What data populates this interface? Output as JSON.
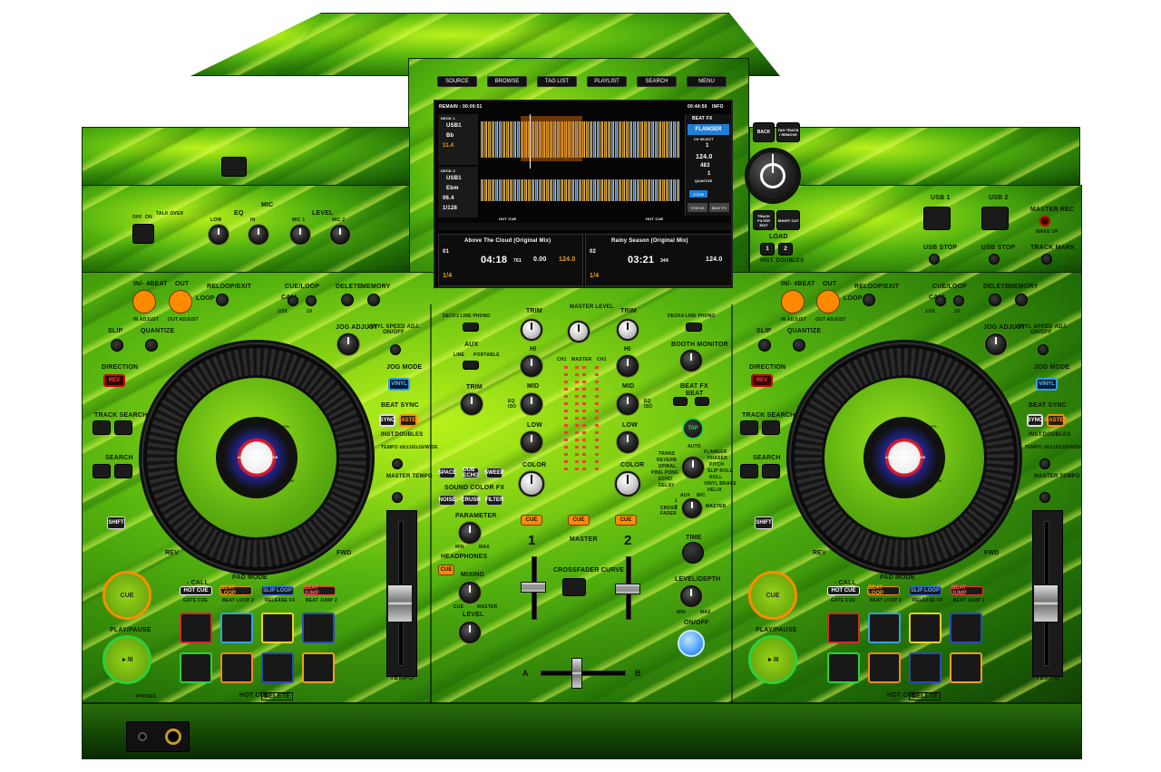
{
  "screen": {
    "top_buttons": [
      "SOURCE",
      "BROWSE",
      "TAG LIST",
      "PLAYLIST",
      "SEARCH",
      "MENU"
    ],
    "remain_label": "REMAIN : 00:00:51",
    "clock": "00:44:50",
    "info_label": "INFO",
    "deck1": {
      "label": "DECK 1",
      "source": "USB1",
      "key": "Bb",
      "bpm_small": "11.4",
      "track_no": "01",
      "title": "Above The Cloud (Original Mix)",
      "time": "04:18",
      "time_ms": "761",
      "tempo": "0.00",
      "bpm": "124.0",
      "quantize": "1/4"
    },
    "deck2": {
      "label": "DECK 2",
      "source": "USB1",
      "key": "Ebm",
      "bpm_small": "06.4",
      "beat_count": "1/128",
      "track_no": "02",
      "title": "Rainy Season (Original Mix)",
      "time": "03:21",
      "time_ms": "344",
      "bpm": "124.0",
      "quantize": "1/4"
    },
    "beat_fx": {
      "header": "BEAT FX",
      "name": "FLANGER",
      "ch": "CH SELECT",
      "value": "1",
      "bpm": "124.0",
      "ms": "483",
      "beat": "1",
      "quantize": "QUANTIZE",
      "zoom": "ZOOM",
      "status": "STATUS",
      "beatfx": "BEAT FX"
    },
    "hot_cue": "HOT CUE"
  },
  "nav": {
    "back": "BACK",
    "tag": "TAG TRACK / REMOVE",
    "track_filter": "TRACK FILTER EDIT",
    "shortcut": "SHORT CUT",
    "load": "LOAD",
    "inst_doubles": "INST. DOUBLES",
    "load1": "1",
    "load2": "2"
  },
  "mic": {
    "title": "MIC",
    "eq": "EQ",
    "level": "LEVEL",
    "off": "OFF",
    "on": "ON",
    "talk_over": "TALK OVER",
    "low": "LOW",
    "hi": "HI",
    "mic1": "MIC 1",
    "mic2": "MIC 2"
  },
  "usb": {
    "usb1": "USB 1",
    "usb2": "USB 2",
    "usb_stop": "USB STOP",
    "master_rec": "MASTER REC",
    "wake_up": "WAKE UP",
    "track_mark": "TRACK MARK"
  },
  "deck_left": {
    "in_beat": "IN/- 4BEAT",
    "out": "OUT",
    "reloop": "RELOOP/EXIT",
    "loop": "LOOP",
    "in_adjust": "IN ADJUST",
    "out_adjust": "OUT ADJUST",
    "cue_loop": "CUE/LOOP",
    "call": "CALL",
    "delete": "DELETE",
    "memory": "MEMORY",
    "half": "1/2X",
    "double": "2X",
    "slip": "SLIP",
    "quantize": "QUANTIZE",
    "jog_adjust": "JOG ADJUST",
    "vinyl_speed": "VINYL SPEED ADJ. ON/OFF",
    "direction": "DIRECTION",
    "rev": "REV",
    "jog_mode": "JOG MODE",
    "vinyl": "VINYL",
    "track_search": "TRACK SEARCH",
    "search": "SEARCH",
    "beat_sync": "BEAT SYNC",
    "sync": "SYNC",
    "master": "MASTER",
    "inst_doubles": "INST.DOUBLES",
    "tempo_range": "TEMPO ±6/±10/±16/WIDE",
    "master_tempo": "MASTER TEMPO",
    "shift": "SHIFT",
    "rev_label": "REV",
    "fwd": "FWD",
    "cue": "CUE",
    "play_pause": "PLAY/PAUSE",
    "play_glyph": "►/II",
    "pad_mode": "PAD MODE",
    "pad_call": "- CALL",
    "hot_cue": "HOT CUE",
    "beat_loop": "BEAT LOOP",
    "slip_loop": "SLIP LOOP",
    "beat_jump": "BEAT JUMP",
    "gate_cue": "GATE CUE",
    "beat_loop2": "BEAT LOOP 2",
    "release_fx": "RELEASE FX",
    "beat_jump2": "BEAT JUMP 2",
    "hot_cue_delete": "HOT CUE",
    "delete_tag": "DELETE",
    "tempo": "TEMPO",
    "phones": "PHONES",
    "jog_mode_label": "MODE",
    "jog_vinyl": "VINYL",
    "jog_sync": "SYNC",
    "jog_master": "MASTER",
    "jog_beat_sync": "BEAT SYNC",
    "jog_track": "ABOVE THE CLOUDS",
    "jog_artist": "LANDMARK"
  },
  "mixer": {
    "deck3_line_phono": "DECK3 LINE PHONO",
    "deck4_line_phono": "DECK4 LINE PHONO",
    "aux": "AUX",
    "portable": "PORTABLE",
    "line": "LINE",
    "trim": "TRIM",
    "master_level": "MASTER LEVEL",
    "hi": "HI",
    "mid": "MID",
    "low": "LOW",
    "eq_iso": "EQ ISO",
    "color": "COLOR",
    "ch1": "CH1",
    "master_meter": "MASTER",
    "ch2": "CH2",
    "booth_monitor": "BOOTH MONITOR",
    "beat_fx": "BEAT FX",
    "beat": "BEAT",
    "tap": "TAP",
    "auto": "AUTO",
    "fx_list_left": [
      "TRANS",
      "REVERB",
      "SPIRAL",
      "PING PONG",
      "ECHO",
      "DELAY"
    ],
    "fx_list_right": [
      "FLANGER",
      "PHASER",
      "PITCH",
      "SLIP ROLL",
      "ROLL",
      "VINYL BRAKE",
      "HELIX"
    ],
    "fx_ch": [
      "AUX",
      "CROSS FADER",
      "1",
      "2",
      "MIC",
      "MASTER"
    ],
    "space": "SPACE",
    "dub_echo": "DUB ECHO",
    "sweep": "SWEEP",
    "noise": "NOISE",
    "crush": "CRUSH",
    "filter": "FILTER",
    "sound_color_fx": "SOUND COLOR FX",
    "parameter": "PARAMETER",
    "min": "MIN",
    "max": "MAX",
    "headphones": "HEADPHONES",
    "cue": "CUE",
    "mixing": "MIXING",
    "cue_small": "CUE",
    "master_small": "MASTER",
    "level": "LEVEL",
    "master_cue": "CUE",
    "master": "MASTER",
    "ch1_num": "1",
    "ch2_num": "2",
    "time": "TIME",
    "level_depth": "LEVEL/DEPTH",
    "on_off": "ON/OFF",
    "crossfader_curve": "CROSSFADER CURVE",
    "xa": "A",
    "xb": "B"
  },
  "deck_right": {
    "in_beat": "IN/- 4BEAT",
    "out": "OUT",
    "reloop": "RELOOP/EXIT",
    "loop": "LOOP",
    "in_adjust": "IN ADJUST",
    "out_adjust": "OUT ADJUST",
    "cue_loop": "CUE/LOOP",
    "call": "CALL",
    "delete": "DELETE",
    "memory": "MEMORY",
    "half": "1/2X",
    "double": "2X",
    "slip": "SLIP",
    "quantize": "QUANTIZE",
    "jog_adjust": "JOG ADJUST",
    "vinyl_speed": "VINYL SPEED ADJ. ON/OFF",
    "direction": "DIRECTION",
    "rev": "REV",
    "jog_mode": "JOG MODE",
    "vinyl": "VINYL",
    "track_search": "TRACK SEARCH",
    "search": "SEARCH",
    "beat_sync": "BEAT SYNC",
    "sync": "SYNC",
    "master": "MASTER",
    "inst_doubles": "INST.DOUBLES",
    "tempo_range": "TEMPO ±6/±10/±16/WIDE",
    "master_tempo": "MASTER TEMPO",
    "shift": "SHIFT",
    "rev_label": "REV",
    "fwd": "FWD",
    "cue": "CUE",
    "play_pause": "PLAY/PAUSE",
    "play_glyph": "►/II",
    "pad_mode": "PAD MODE",
    "pad_call": "- CALL",
    "hot_cue": "HOT CUE",
    "beat_loop": "BEAT LOOP",
    "slip_loop": "SLIP LOOP",
    "beat_jump": "BEAT JUMP",
    "gate_cue": "GATE CUE",
    "beat_loop2": "BEAT LOOP 2",
    "release_fx": "RELEASE FX",
    "beat_jump2": "BEAT JUMP 2",
    "hot_cue_delete": "HOT CUE",
    "delete_tag": "DELETE",
    "tempo": "TEMPO",
    "jog_mode_label": "MODE",
    "jog_vinyl": "VINYL",
    "jog_sync": "SYNC",
    "jog_master": "MASTER",
    "jog_beat_sync": "BEAT SYNC",
    "jog_track": "ABOVE THE CLOUDS",
    "jog_artist": "LANDMARK"
  },
  "colors": {
    "pad_red": "#d4282c",
    "pad_blue": "#2ea4e0",
    "pad_yellow": "#f0d020",
    "pad_navy": "#2a4ab8",
    "pad_orange": "#f08a1a",
    "led_orange": "#ff8c00"
  }
}
